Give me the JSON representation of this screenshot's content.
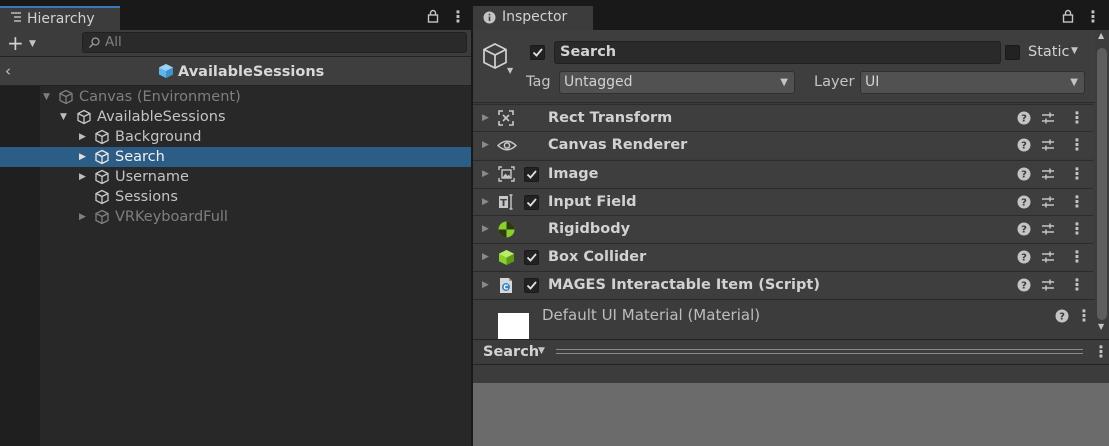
{
  "hierarchy": {
    "tab_label": "Hierarchy",
    "add_label": "+",
    "search_placeholder": "All",
    "scene_title": "AvailableSessions",
    "items": [
      {
        "label": "Canvas (Environment)",
        "dim": true
      },
      {
        "label": "AvailableSessions",
        "dim": false
      },
      {
        "label": "Background",
        "dim": false
      },
      {
        "label": "Search",
        "dim": false,
        "selected": true
      },
      {
        "label": "Username",
        "dim": false
      },
      {
        "label": "Sessions",
        "dim": false
      },
      {
        "label": "VRKeyboardFull",
        "dim": true
      }
    ]
  },
  "inspector": {
    "tab_label": "Inspector",
    "object_name": "Search",
    "active": true,
    "static_label": "Static",
    "tag_label": "Tag",
    "tag_value": "Untagged",
    "layer_label": "Layer",
    "layer_value": "UI",
    "components": [
      {
        "name": "Rect Transform",
        "icon": "rect-transform-icon",
        "checkbox": false
      },
      {
        "name": "Canvas Renderer",
        "icon": "eye-icon",
        "checkbox": false
      },
      {
        "name": "Image",
        "icon": "image-icon",
        "checkbox": true
      },
      {
        "name": "Input Field",
        "icon": "input-field-icon",
        "checkbox": true
      },
      {
        "name": "Rigidbody",
        "icon": "rigidbody-icon",
        "checkbox": false
      },
      {
        "name": "Box Collider",
        "icon": "box-collider-icon",
        "checkbox": true
      },
      {
        "name": "MAGES Interactable Item (Script)",
        "icon": "script-icon",
        "checkbox": true
      }
    ],
    "material_label": "Default UI Material (Material)",
    "bottom_search_label": "Search"
  },
  "colors": {
    "selection": "#2c5d87",
    "tab_accent": "#3a79bb",
    "cube_blue": "#5fb5e8",
    "rigidbody_green": "#8bd12c"
  }
}
